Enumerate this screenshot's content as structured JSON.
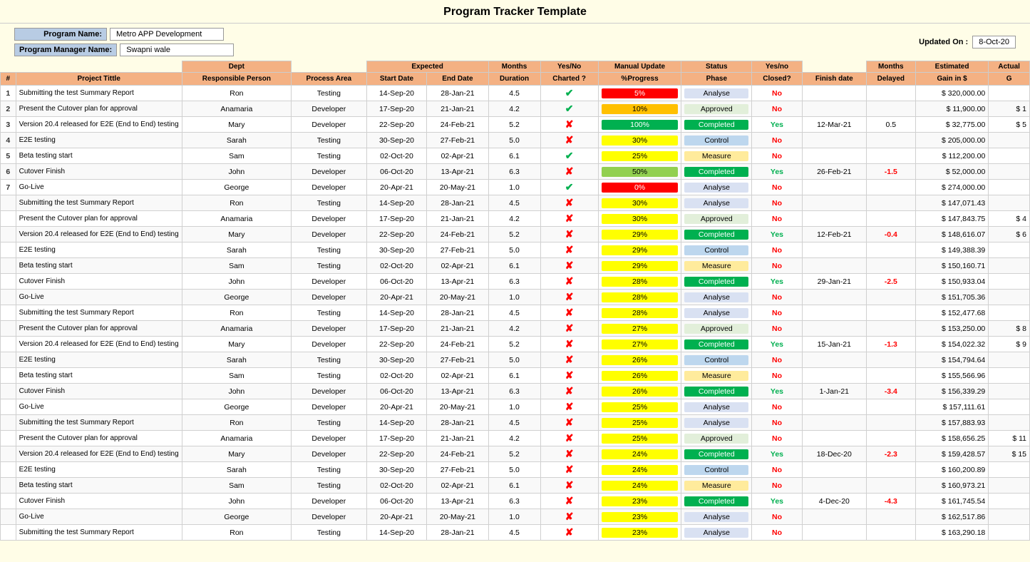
{
  "title": "Program Tracker Template",
  "header": {
    "program_name_label": "Program Name:",
    "program_name_value": "Metro APP Development",
    "program_manager_label": "Program Manager Name:",
    "program_manager_value": "Swapni wale",
    "updated_on_label": "Updated On :",
    "updated_on_value": "8-Oct-20"
  },
  "col_groups": [
    {
      "label": "",
      "colspan": 1
    },
    {
      "label": "",
      "colspan": 1
    },
    {
      "label": "Dept",
      "colspan": 1
    },
    {
      "label": "",
      "colspan": 1
    },
    {
      "label": "Expected",
      "colspan": 2
    },
    {
      "label": "Months",
      "colspan": 1
    },
    {
      "label": "Yes/No",
      "colspan": 1
    },
    {
      "label": "Manual Update",
      "colspan": 1
    },
    {
      "label": "Status",
      "colspan": 1
    },
    {
      "label": "Yes/no",
      "colspan": 1
    },
    {
      "label": "",
      "colspan": 1
    },
    {
      "label": "Months",
      "colspan": 1
    },
    {
      "label": "Estimated",
      "colspan": 1
    },
    {
      "label": "Actual",
      "colspan": 1
    }
  ],
  "col_headers": [
    "#",
    "Project Tittle",
    "Responsible Person",
    "Process Area",
    "Start Date",
    "End Date",
    "Duration",
    "Charted ?",
    "%Progress",
    "Phase",
    "Closed?",
    "Finish date",
    "Delayed",
    "Gain in $",
    "G"
  ],
  "rows": [
    {
      "num": "1",
      "title": "Submitting the test Summary Report",
      "person": "Ron",
      "area": "Testing",
      "start": "14-Sep-20",
      "end": "28-Jan-21",
      "duration": "4.5",
      "charted": "check",
      "progress": "5%",
      "prog_class": "prog-red",
      "phase": "Analyse",
      "phase_class": "phase-analyse",
      "closed": "No",
      "closed_class": "closed-no",
      "finish": "",
      "delayed": "",
      "gain": "$ 320,000.00",
      "actual": ""
    },
    {
      "num": "2",
      "title": "Present the Cutover plan for approval",
      "person": "Anamaria",
      "area": "Developer",
      "start": "17-Sep-20",
      "end": "21-Jan-21",
      "duration": "4.2",
      "charted": "check",
      "progress": "10%",
      "prog_class": "prog-orange",
      "phase": "Approved",
      "phase_class": "phase-approved",
      "closed": "No",
      "closed_class": "closed-no",
      "finish": "",
      "delayed": "",
      "gain": "$ 11,900.00",
      "actual": "$ 1"
    },
    {
      "num": "3",
      "title": "Version 20.4 released for E2E (End to End) testing",
      "person": "Mary",
      "area": "Developer",
      "start": "22-Sep-20",
      "end": "24-Feb-21",
      "duration": "5.2",
      "charted": "cross",
      "progress": "100%",
      "prog_class": "prog-darkgreen",
      "phase": "Completed",
      "phase_class": "phase-completed",
      "closed": "Yes",
      "closed_class": "closed-yes",
      "finish": "12-Mar-21",
      "delayed": "0.5",
      "delayed_class": "delayed-pos",
      "gain": "$ 32,775.00",
      "actual": "$ 5"
    },
    {
      "num": "4",
      "title": "E2E testing",
      "person": "Sarah",
      "area": "Testing",
      "start": "30-Sep-20",
      "end": "27-Feb-21",
      "duration": "5.0",
      "charted": "cross",
      "progress": "30%",
      "prog_class": "prog-yellow",
      "phase": "Control",
      "phase_class": "phase-control",
      "closed": "No",
      "closed_class": "closed-no",
      "finish": "",
      "delayed": "",
      "gain": "$ 205,000.00",
      "actual": ""
    },
    {
      "num": "5",
      "title": "Beta testing start",
      "person": "Sam",
      "area": "Testing",
      "start": "02-Oct-20",
      "end": "02-Apr-21",
      "duration": "6.1",
      "charted": "check",
      "progress": "25%",
      "prog_class": "prog-yellow",
      "phase": "Measure",
      "phase_class": "phase-measure",
      "closed": "No",
      "closed_class": "closed-no",
      "finish": "",
      "delayed": "",
      "gain": "$ 112,200.00",
      "actual": ""
    },
    {
      "num": "6",
      "title": "Cutover Finish",
      "person": "John",
      "area": "Developer",
      "start": "06-Oct-20",
      "end": "13-Apr-21",
      "duration": "6.3",
      "charted": "cross",
      "progress": "50%",
      "prog_class": "prog-green",
      "phase": "Completed",
      "phase_class": "phase-completed",
      "closed": "Yes",
      "closed_class": "closed-yes",
      "finish": "26-Feb-21",
      "delayed": "-1.5",
      "delayed_class": "delayed-neg",
      "gain": "$ 52,000.00",
      "actual": ""
    },
    {
      "num": "7",
      "title": "Go-Live",
      "person": "George",
      "area": "Developer",
      "start": "20-Apr-21",
      "end": "20-May-21",
      "duration": "1.0",
      "charted": "check",
      "progress": "0%",
      "prog_class": "prog-red",
      "phase": "Analyse",
      "phase_class": "phase-analyse",
      "closed": "No",
      "closed_class": "closed-no",
      "finish": "",
      "delayed": "",
      "gain": "$ 274,000.00",
      "actual": ""
    },
    {
      "num": "",
      "title": "Submitting the test Summary Report",
      "person": "Ron",
      "area": "Testing",
      "start": "14-Sep-20",
      "end": "28-Jan-21",
      "duration": "4.5",
      "charted": "cross",
      "progress": "30%",
      "prog_class": "prog-yellow",
      "phase": "Analyse",
      "phase_class": "phase-analyse",
      "closed": "No",
      "closed_class": "closed-no",
      "finish": "",
      "delayed": "",
      "gain": "$ 147,071.43",
      "actual": ""
    },
    {
      "num": "",
      "title": "Present the Cutover plan for approval",
      "person": "Anamaria",
      "area": "Developer",
      "start": "17-Sep-20",
      "end": "21-Jan-21",
      "duration": "4.2",
      "charted": "cross",
      "progress": "30%",
      "prog_class": "prog-yellow",
      "phase": "Approved",
      "phase_class": "phase-approved",
      "closed": "No",
      "closed_class": "closed-no",
      "finish": "",
      "delayed": "",
      "gain": "$ 147,843.75",
      "actual": "$ 4"
    },
    {
      "num": "",
      "title": "Version 20.4 released for E2E (End to End) testing",
      "person": "Mary",
      "area": "Developer",
      "start": "22-Sep-20",
      "end": "24-Feb-21",
      "duration": "5.2",
      "charted": "cross",
      "progress": "29%",
      "prog_class": "prog-yellow",
      "phase": "Completed",
      "phase_class": "phase-completed",
      "closed": "Yes",
      "closed_class": "closed-yes",
      "finish": "12-Feb-21",
      "delayed": "-0.4",
      "delayed_class": "delayed-neg",
      "gain": "$ 148,616.07",
      "actual": "$ 6"
    },
    {
      "num": "",
      "title": "E2E testing",
      "person": "Sarah",
      "area": "Testing",
      "start": "30-Sep-20",
      "end": "27-Feb-21",
      "duration": "5.0",
      "charted": "cross",
      "progress": "29%",
      "prog_class": "prog-yellow",
      "phase": "Control",
      "phase_class": "phase-control",
      "closed": "No",
      "closed_class": "closed-no",
      "finish": "",
      "delayed": "",
      "gain": "$ 149,388.39",
      "actual": ""
    },
    {
      "num": "",
      "title": "Beta testing start",
      "person": "Sam",
      "area": "Testing",
      "start": "02-Oct-20",
      "end": "02-Apr-21",
      "duration": "6.1",
      "charted": "cross",
      "progress": "29%",
      "prog_class": "prog-yellow",
      "phase": "Measure",
      "phase_class": "phase-measure",
      "closed": "No",
      "closed_class": "closed-no",
      "finish": "",
      "delayed": "",
      "gain": "$ 150,160.71",
      "actual": ""
    },
    {
      "num": "",
      "title": "Cutover Finish",
      "person": "John",
      "area": "Developer",
      "start": "06-Oct-20",
      "end": "13-Apr-21",
      "duration": "6.3",
      "charted": "cross",
      "progress": "28%",
      "prog_class": "prog-yellow",
      "phase": "Completed",
      "phase_class": "phase-completed",
      "closed": "Yes",
      "closed_class": "closed-yes",
      "finish": "29-Jan-21",
      "delayed": "-2.5",
      "delayed_class": "delayed-neg",
      "gain": "$ 150,933.04",
      "actual": ""
    },
    {
      "num": "",
      "title": "Go-Live",
      "person": "George",
      "area": "Developer",
      "start": "20-Apr-21",
      "end": "20-May-21",
      "duration": "1.0",
      "charted": "cross",
      "progress": "28%",
      "prog_class": "prog-yellow",
      "phase": "Analyse",
      "phase_class": "phase-analyse",
      "closed": "No",
      "closed_class": "closed-no",
      "finish": "",
      "delayed": "",
      "gain": "$ 151,705.36",
      "actual": ""
    },
    {
      "num": "",
      "title": "Submitting the test Summary Report",
      "person": "Ron",
      "area": "Testing",
      "start": "14-Sep-20",
      "end": "28-Jan-21",
      "duration": "4.5",
      "charted": "cross",
      "progress": "28%",
      "prog_class": "prog-yellow",
      "phase": "Analyse",
      "phase_class": "phase-analyse",
      "closed": "No",
      "closed_class": "closed-no",
      "finish": "",
      "delayed": "",
      "gain": "$ 152,477.68",
      "actual": ""
    },
    {
      "num": "",
      "title": "Present the Cutover plan for approval",
      "person": "Anamaria",
      "area": "Developer",
      "start": "17-Sep-20",
      "end": "21-Jan-21",
      "duration": "4.2",
      "charted": "cross",
      "progress": "27%",
      "prog_class": "prog-yellow",
      "phase": "Approved",
      "phase_class": "phase-approved",
      "closed": "No",
      "closed_class": "closed-no",
      "finish": "",
      "delayed": "",
      "gain": "$ 153,250.00",
      "actual": "$ 8"
    },
    {
      "num": "",
      "title": "Version 20.4 released for E2E (End to End) testing",
      "person": "Mary",
      "area": "Developer",
      "start": "22-Sep-20",
      "end": "24-Feb-21",
      "duration": "5.2",
      "charted": "cross",
      "progress": "27%",
      "prog_class": "prog-yellow",
      "phase": "Completed",
      "phase_class": "phase-completed",
      "closed": "Yes",
      "closed_class": "closed-yes",
      "finish": "15-Jan-21",
      "delayed": "-1.3",
      "delayed_class": "delayed-neg",
      "gain": "$ 154,022.32",
      "actual": "$ 9"
    },
    {
      "num": "",
      "title": "E2E testing",
      "person": "Sarah",
      "area": "Testing",
      "start": "30-Sep-20",
      "end": "27-Feb-21",
      "duration": "5.0",
      "charted": "cross",
      "progress": "26%",
      "prog_class": "prog-yellow",
      "phase": "Control",
      "phase_class": "phase-control",
      "closed": "No",
      "closed_class": "closed-no",
      "finish": "",
      "delayed": "",
      "gain": "$ 154,794.64",
      "actual": ""
    },
    {
      "num": "",
      "title": "Beta testing start",
      "person": "Sam",
      "area": "Testing",
      "start": "02-Oct-20",
      "end": "02-Apr-21",
      "duration": "6.1",
      "charted": "cross",
      "progress": "26%",
      "prog_class": "prog-yellow",
      "phase": "Measure",
      "phase_class": "phase-measure",
      "closed": "No",
      "closed_class": "closed-no",
      "finish": "",
      "delayed": "",
      "gain": "$ 155,566.96",
      "actual": ""
    },
    {
      "num": "",
      "title": "Cutover Finish",
      "person": "John",
      "area": "Developer",
      "start": "06-Oct-20",
      "end": "13-Apr-21",
      "duration": "6.3",
      "charted": "cross",
      "progress": "26%",
      "prog_class": "prog-yellow",
      "phase": "Completed",
      "phase_class": "phase-completed",
      "closed": "Yes",
      "closed_class": "closed-yes",
      "finish": "1-Jan-21",
      "delayed": "-3.4",
      "delayed_class": "delayed-neg",
      "gain": "$ 156,339.29",
      "actual": ""
    },
    {
      "num": "",
      "title": "Go-Live",
      "person": "George",
      "area": "Developer",
      "start": "20-Apr-21",
      "end": "20-May-21",
      "duration": "1.0",
      "charted": "cross",
      "progress": "25%",
      "prog_class": "prog-yellow",
      "phase": "Analyse",
      "phase_class": "phase-analyse",
      "closed": "No",
      "closed_class": "closed-no",
      "finish": "",
      "delayed": "",
      "gain": "$ 157,111.61",
      "actual": ""
    },
    {
      "num": "",
      "title": "Submitting the test Summary Report",
      "person": "Ron",
      "area": "Testing",
      "start": "14-Sep-20",
      "end": "28-Jan-21",
      "duration": "4.5",
      "charted": "cross",
      "progress": "25%",
      "prog_class": "prog-yellow",
      "phase": "Analyse",
      "phase_class": "phase-analyse",
      "closed": "No",
      "closed_class": "closed-no",
      "finish": "",
      "delayed": "",
      "gain": "$ 157,883.93",
      "actual": ""
    },
    {
      "num": "",
      "title": "Present the Cutover plan for approval",
      "person": "Anamaria",
      "area": "Developer",
      "start": "17-Sep-20",
      "end": "21-Jan-21",
      "duration": "4.2",
      "charted": "cross",
      "progress": "25%",
      "prog_class": "prog-yellow",
      "phase": "Approved",
      "phase_class": "phase-approved",
      "closed": "No",
      "closed_class": "closed-no",
      "finish": "",
      "delayed": "",
      "gain": "$ 158,656.25",
      "actual": "$ 11"
    },
    {
      "num": "",
      "title": "Version 20.4 released for E2E (End to End) testing",
      "person": "Mary",
      "area": "Developer",
      "start": "22-Sep-20",
      "end": "24-Feb-21",
      "duration": "5.2",
      "charted": "cross",
      "progress": "24%",
      "prog_class": "prog-yellow",
      "phase": "Completed",
      "phase_class": "phase-completed",
      "closed": "Yes",
      "closed_class": "closed-yes",
      "finish": "18-Dec-20",
      "delayed": "-2.3",
      "delayed_class": "delayed-neg",
      "gain": "$ 159,428.57",
      "actual": "$ 15"
    },
    {
      "num": "",
      "title": "E2E testing",
      "person": "Sarah",
      "area": "Testing",
      "start": "30-Sep-20",
      "end": "27-Feb-21",
      "duration": "5.0",
      "charted": "cross",
      "progress": "24%",
      "prog_class": "prog-yellow",
      "phase": "Control",
      "phase_class": "phase-control",
      "closed": "No",
      "closed_class": "closed-no",
      "finish": "",
      "delayed": "",
      "gain": "$ 160,200.89",
      "actual": ""
    },
    {
      "num": "",
      "title": "Beta testing start",
      "person": "Sam",
      "area": "Testing",
      "start": "02-Oct-20",
      "end": "02-Apr-21",
      "duration": "6.1",
      "charted": "cross",
      "progress": "24%",
      "prog_class": "prog-yellow",
      "phase": "Measure",
      "phase_class": "phase-measure",
      "closed": "No",
      "closed_class": "closed-no",
      "finish": "",
      "delayed": "",
      "gain": "$ 160,973.21",
      "actual": ""
    },
    {
      "num": "",
      "title": "Cutover Finish",
      "person": "John",
      "area": "Developer",
      "start": "06-Oct-20",
      "end": "13-Apr-21",
      "duration": "6.3",
      "charted": "cross",
      "progress": "23%",
      "prog_class": "prog-yellow",
      "phase": "Completed",
      "phase_class": "phase-completed",
      "closed": "Yes",
      "closed_class": "closed-yes",
      "finish": "4-Dec-20",
      "delayed": "-4.3",
      "delayed_class": "delayed-neg",
      "gain": "$ 161,745.54",
      "actual": ""
    },
    {
      "num": "",
      "title": "Go-Live",
      "person": "George",
      "area": "Developer",
      "start": "20-Apr-21",
      "end": "20-May-21",
      "duration": "1.0",
      "charted": "cross",
      "progress": "23%",
      "prog_class": "prog-yellow",
      "phase": "Analyse",
      "phase_class": "phase-analyse",
      "closed": "No",
      "closed_class": "closed-no",
      "finish": "",
      "delayed": "",
      "gain": "$ 162,517.86",
      "actual": ""
    },
    {
      "num": "",
      "title": "Submitting the test Summary Report",
      "person": "Ron",
      "area": "Testing",
      "start": "14-Sep-20",
      "end": "28-Jan-21",
      "duration": "4.5",
      "charted": "cross",
      "progress": "23%",
      "prog_class": "prog-yellow",
      "phase": "Analyse",
      "phase_class": "phase-analyse",
      "closed": "No",
      "closed_class": "closed-no",
      "finish": "",
      "delayed": "",
      "gain": "$ 163,290.18",
      "actual": ""
    }
  ]
}
